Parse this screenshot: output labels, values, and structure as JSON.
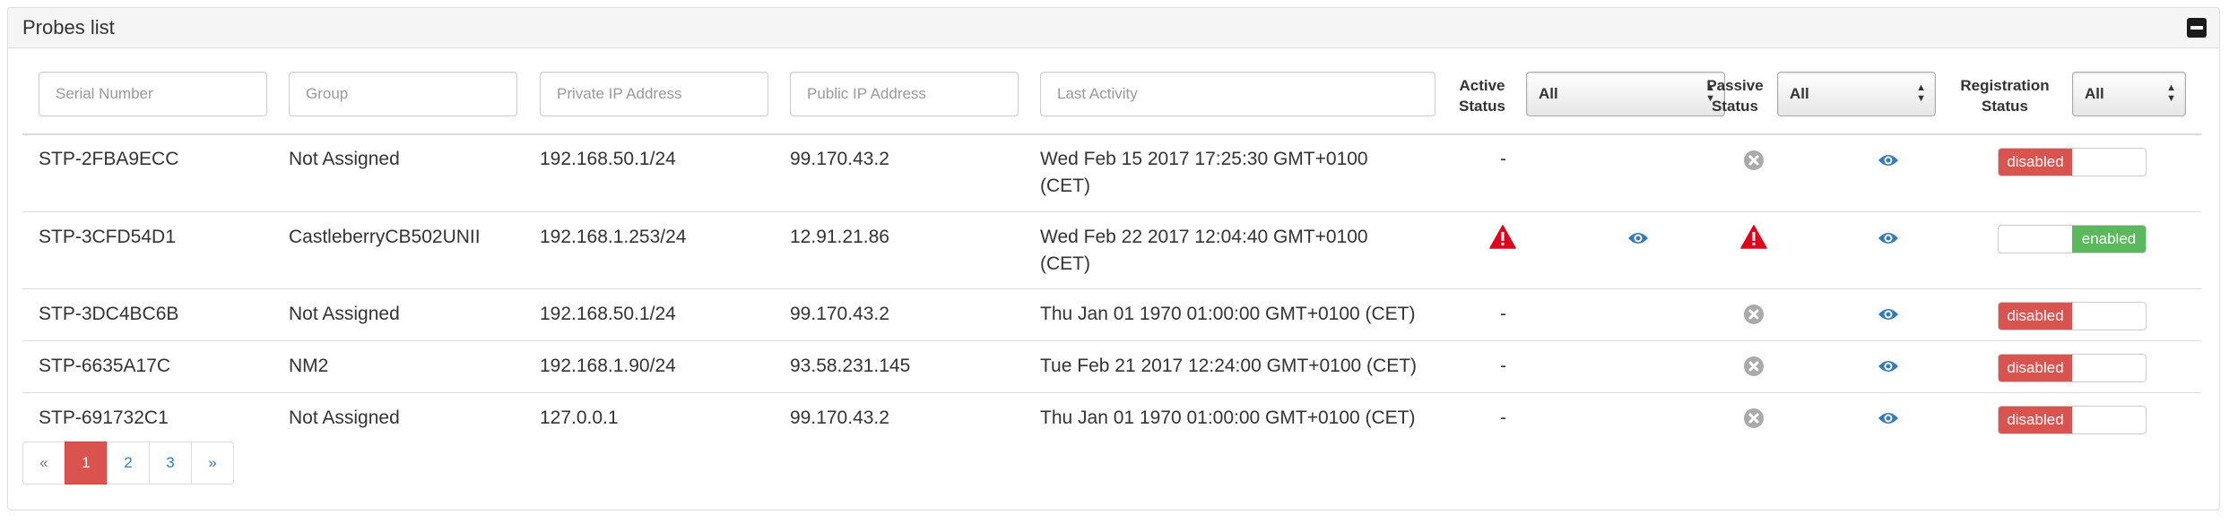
{
  "panel": {
    "title": "Probes list",
    "collapse_icon": "minus-square-icon"
  },
  "filters": {
    "serial_placeholder": "Serial Number",
    "group_placeholder": "Group",
    "private_ip_placeholder": "Private IP Address",
    "public_ip_placeholder": "Public IP Address",
    "last_activity_placeholder": "Last Activity",
    "active_status_label": "Active\nStatus",
    "active_status_value": "All",
    "passive_status_label": "Passive\nStatus",
    "passive_status_value": "All",
    "registration_status_label": "Registration\nStatus",
    "registration_status_value": "All"
  },
  "rows": [
    {
      "serial": "STP-2FBA9ECC",
      "group": "Not Assigned",
      "private_ip": "192.168.50.1/24",
      "public_ip": "99.170.43.2",
      "last_activity": "Wed Feb 15 2017 17:25:30 GMT+0100\n(CET)",
      "active": "-",
      "passive_icon": "x-circle-icon",
      "view_icon": "eye-icon",
      "registration": "disabled"
    },
    {
      "serial": "STP-3CFD54D1",
      "group": "CastleberryCB502UNII",
      "private_ip": "192.168.1.253/24",
      "public_ip": "12.91.21.86",
      "last_activity": "Wed Feb 22 2017 12:04:40 GMT+0100\n(CET)",
      "active_icon": "warning-icon",
      "active_view_icon": "eye-icon",
      "passive_icon": "warning-icon",
      "view_icon": "eye-icon",
      "registration": "enabled"
    },
    {
      "serial": "STP-3DC4BC6B",
      "group": "Not Assigned",
      "private_ip": "192.168.50.1/24",
      "public_ip": "99.170.43.2",
      "last_activity": "Thu Jan 01 1970 01:00:00 GMT+0100 (CET)",
      "active": "-",
      "passive_icon": "x-circle-icon",
      "view_icon": "eye-icon",
      "registration": "disabled"
    },
    {
      "serial": "STP-6635A17C",
      "group": "NM2",
      "private_ip": "192.168.1.90/24",
      "public_ip": "93.58.231.145",
      "last_activity": "Tue Feb 21 2017 12:24:00 GMT+0100 (CET)",
      "active": "-",
      "passive_icon": "x-circle-icon",
      "view_icon": "eye-icon",
      "registration": "disabled"
    },
    {
      "serial": "STP-691732C1",
      "group": "Not Assigned",
      "private_ip": "127.0.0.1",
      "public_ip": "99.170.43.2",
      "last_activity": "Thu Jan 01 1970 01:00:00 GMT+0100 (CET)",
      "active": "-",
      "passive_icon": "x-circle-icon",
      "view_icon": "eye-icon",
      "registration": "disabled"
    }
  ],
  "pagination": {
    "prev": "«",
    "pages": [
      "1",
      "2",
      "3"
    ],
    "next": "»",
    "current": "1"
  },
  "colors": {
    "danger": "#d9534f",
    "success": "#5cb85c",
    "link": "#337ab7",
    "warning": "#e0001b",
    "muted": "#aaaaaa"
  }
}
